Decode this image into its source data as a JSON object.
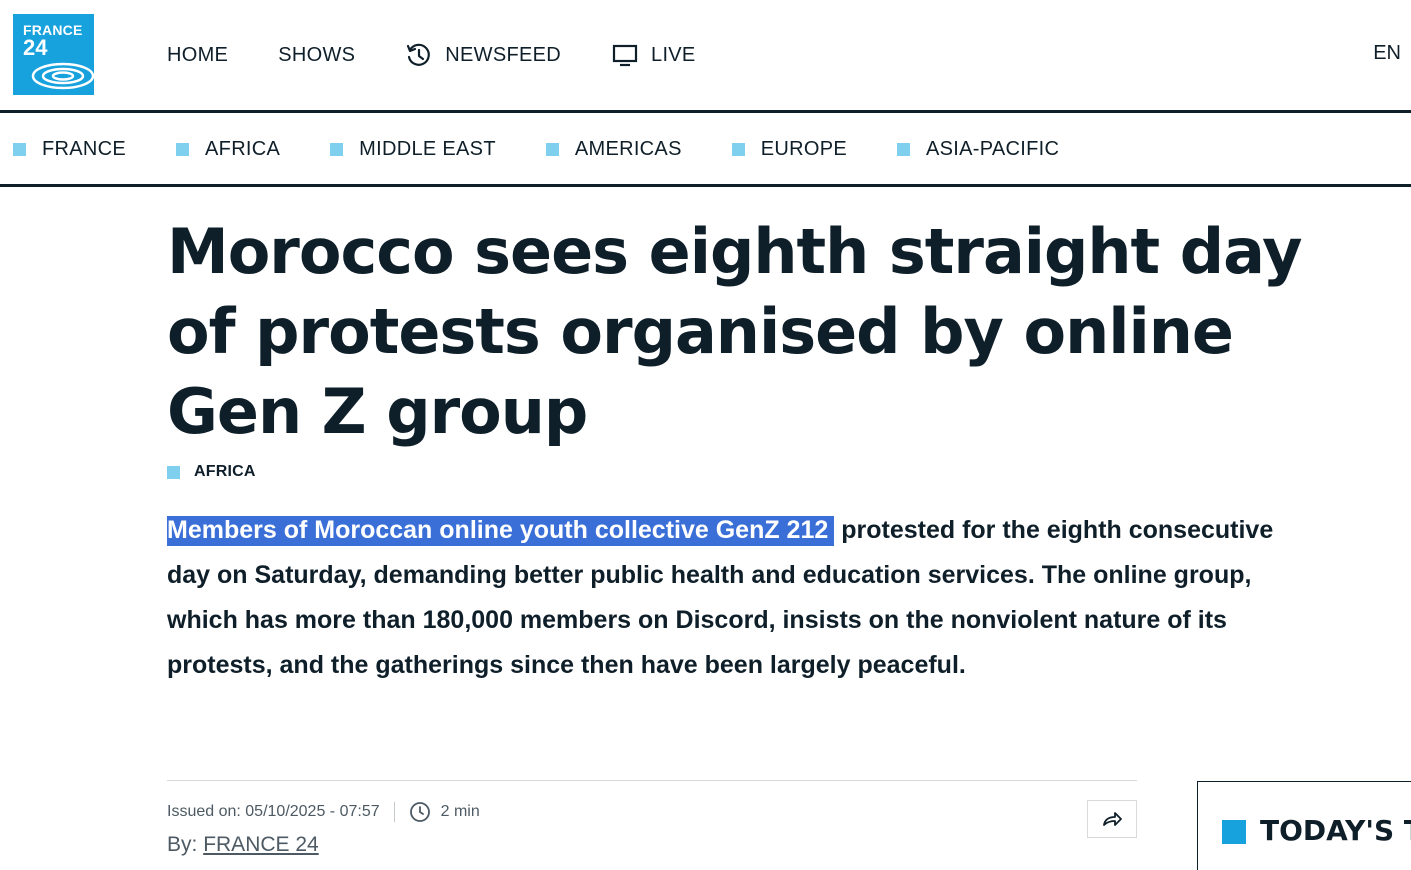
{
  "logo": {
    "line1": "FRANCE",
    "line2": "24",
    "color": "#17a1dd"
  },
  "main_nav": [
    {
      "label": "HOME",
      "icon": null
    },
    {
      "label": "SHOWS",
      "icon": null
    },
    {
      "label": "NEWSFEED",
      "icon": "history-clock-icon"
    },
    {
      "label": "LIVE",
      "icon": "tv-icon"
    }
  ],
  "language": "EN",
  "section_nav": [
    "FRANCE",
    "AFRICA",
    "MIDDLE EAST",
    "AMERICAS",
    "EUROPE",
    "ASIA-PACIFIC"
  ],
  "article": {
    "headline": "Morocco sees eighth straight day of protests organised by online Gen Z group",
    "category": "AFRICA",
    "lead_highlighted": "Members of Moroccan online youth collective GenZ 212",
    "lead_rest": " protested for the eighth consecutive day on Saturday, demanding better public health and education services. The online group, which has more than 180,000 members on Discord, insists on the nonviolent nature of its protests, and the gatherings since then have been largely peaceful.",
    "issued_on": "Issued on: 05/10/2025 - 07:57",
    "read_time": "2 min",
    "by_label": "By:",
    "author": "FRANCE 24"
  },
  "side_widget": {
    "title": "TODAY'S T"
  },
  "colors": {
    "accent": "#17a1dd",
    "section_square": "#7fd0ef",
    "highlight": "#3a6fd8",
    "text": "#0f1f2a"
  }
}
